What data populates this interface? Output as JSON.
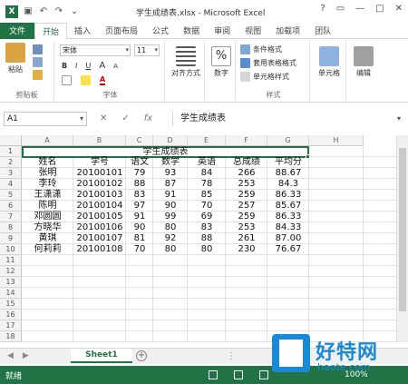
{
  "window": {
    "title": "学生成绩表.xlsx - Microsoft Excel",
    "controls": [
      "?",
      "▭",
      "—",
      "□",
      "✕"
    ],
    "logo": "X",
    "qat": [
      {
        "icon": "save-icon",
        "glyph": "▣"
      },
      {
        "icon": "undo-icon",
        "glyph": "↶"
      },
      {
        "icon": "redo-icon",
        "glyph": "↷"
      },
      {
        "icon": "customize-qat-icon",
        "glyph": "⌄"
      }
    ]
  },
  "tabs": {
    "file": "文件",
    "items": [
      "开始",
      "插入",
      "页面布局",
      "公式",
      "数据",
      "审阅",
      "视图",
      "加载项",
      "团队"
    ],
    "active": "开始",
    "account": ""
  },
  "ribbon": {
    "clipboard": {
      "paste": "粘贴",
      "label": "剪贴板"
    },
    "font": {
      "name": "宋体",
      "size": "11",
      "bold": "B",
      "italic": "I",
      "underline": "U",
      "font_color_glyph": "A",
      "grow": "A",
      "shrink": "A",
      "label": "字体"
    },
    "alignment": {
      "button": "对齐方式"
    },
    "number": {
      "symbol": "%",
      "button": "数字"
    },
    "styles": {
      "conditional": "条件格式",
      "table": "套用表格格式",
      "cell_styles": "单元格样式",
      "label": "样式"
    },
    "cells": {
      "button": "单元格"
    },
    "editing": {
      "button": "编辑"
    }
  },
  "formula_bar": {
    "name_box": "A1",
    "cancel": "✕",
    "confirm": "✓",
    "fx": "fx",
    "content": "学生成绩表"
  },
  "columns": [
    "A",
    "B",
    "C",
    "D",
    "E",
    "F",
    "G",
    "H"
  ],
  "rows": [
    "1",
    "2",
    "3",
    "4",
    "5",
    "6",
    "7",
    "8",
    "9",
    "10",
    "11",
    "12",
    "13",
    "14",
    "15",
    "16",
    "17",
    "18"
  ],
  "sheet": {
    "title": "学生成绩表",
    "headers": [
      "姓名",
      "学号",
      "语文",
      "数学",
      "英语",
      "总成绩",
      "平均分"
    ],
    "rows": [
      [
        "张明",
        "20100101",
        "79",
        "93",
        "84",
        "266",
        "88.67"
      ],
      [
        "李玲",
        "20100102",
        "88",
        "87",
        "78",
        "253",
        "84.3"
      ],
      [
        "王潇潇",
        "20100103",
        "83",
        "91",
        "85",
        "259",
        "86.33"
      ],
      [
        "陈明",
        "20100104",
        "97",
        "90",
        "70",
        "257",
        "85.67"
      ],
      [
        "邓圆圆",
        "20100105",
        "91",
        "99",
        "69",
        "259",
        "86.33"
      ],
      [
        "方晓华",
        "20100106",
        "90",
        "80",
        "83",
        "253",
        "84.33"
      ],
      [
        "黄琪",
        "20100107",
        "81",
        "92",
        "88",
        "261",
        "87.00"
      ],
      [
        "何莉莉",
        "20100108",
        "70",
        "80",
        "80",
        "230",
        "76.67"
      ]
    ]
  },
  "sheet_tabs": {
    "active": "Sheet1",
    "add": "+",
    "nav": [
      "◀",
      "▶"
    ],
    "more": "⋮"
  },
  "status": {
    "text": "就绪",
    "zoom": "100%"
  },
  "watermark": {
    "brand": "好特网",
    "url": "haote.com"
  }
}
